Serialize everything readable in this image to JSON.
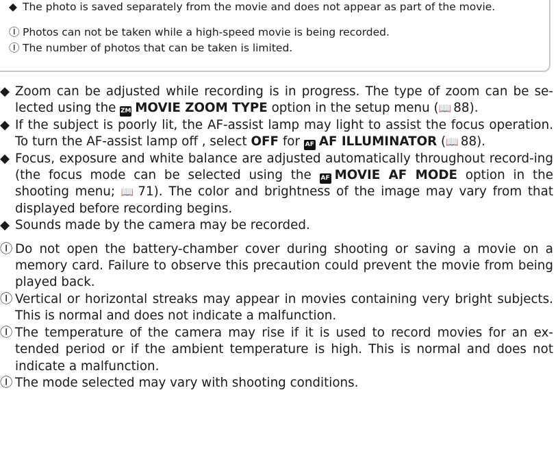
{
  "symbols": {
    "bullet": "◆",
    "caution": "Ⓘ",
    "book": "📖"
  },
  "note_box": {
    "line1": "The photo is saved separately from the movie and does not appear as part of the movie.",
    "line2": "Photos can not be taken while a high-speed movie is being recorded.",
    "line3": "The number of photos that can be taken is limited."
  },
  "tips": {
    "zoom": {
      "a": "Zoom can be adjusted while recording is in progress. The type of zoom can be se-lected using the",
      "icon": "ZM",
      "label": "MOVIE ZOOM TYPE",
      "b": "option in the setup menu (",
      "page": "88",
      "c": ")."
    },
    "af_assist": {
      "a": "If the subject is poorly lit, the AF-assist lamp may light to assist the focus operation. To turn the AF-assist lamp off , select",
      "off": "OFF",
      "mid": "for",
      "icon": "AF",
      "label": "AF ILLUMINATOR",
      "b": "(",
      "page": "88",
      "c": ")."
    },
    "focus": {
      "a": "Focus, exposure and white balance are adjusted automatically throughout record-ing (the focus mode can be selected using the",
      "icon": "AF",
      "label": "MOVIE AF MODE",
      "b": "option in the shooting menu;",
      "page": "71",
      "c": "). The color and brightness of the image may vary from that displayed before recording begins."
    },
    "sounds": "Sounds made by the camera may be recorded."
  },
  "cautions": {
    "battery": "Do not open the battery-chamber cover during shooting or saving a movie on a memory card.  Failure to observe this precaution could prevent the movie from being played back.",
    "streaks": "Vertical or horizontal streaks may appear in movies containing very bright subjects. This is normal and does not indicate a malfunction.",
    "temperature": "The temperature of the camera may rise if it is used to record movies for an ex-tended period or if the ambient temperature is high.  This is normal and does not indicate a malfunction.",
    "mode": "The mode selected may vary with shooting conditions."
  }
}
